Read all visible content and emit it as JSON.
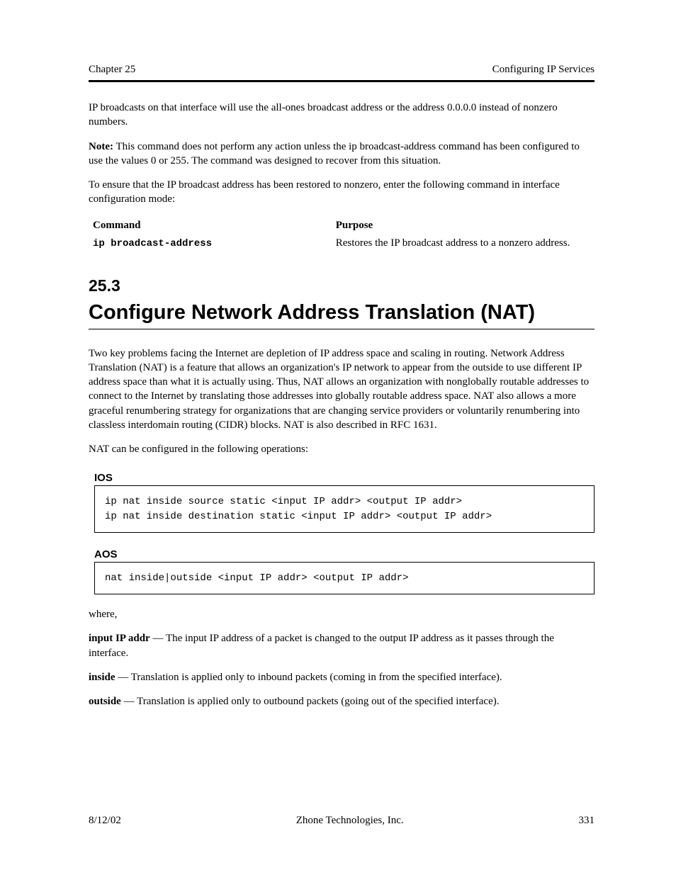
{
  "header": {
    "left": "Chapter 25",
    "right": "Configuring IP Services"
  },
  "para1": "IP broadcasts on that interface will use the all-ones broadcast address or the address 0.0.0.0 instead of nonzero numbers.",
  "note_lead": "Note:",
  "note_body": "This command does not perform any action unless the ip broadcast-address command has been configured to use the values 0 or 255. The command was designed to recover from this situation.",
  "para2": "To ensure that the IP broadcast address has been restored to nonzero, enter the following command in interface configuration mode:",
  "table1": {
    "cmd_label": "Command",
    "purpose_label": "Purpose",
    "cmd": "ip broadcast-address",
    "purpose": "Restores the IP broadcast address to a nonzero address."
  },
  "section": {
    "num": "25.3",
    "title": "Configure Network Address Translation (NAT)"
  },
  "para3": "Two key problems facing the Internet are depletion of IP address space and scaling in routing. Network Address Translation (NAT) is a feature that allows an organization's IP network to appear from the outside to use different IP address space than what it is actually using. Thus, NAT allows an organization with nonglobally routable addresses to connect to the Internet by translating those addresses into globally routable address space. NAT also allows a more graceful renumbering strategy for organizations that are changing service providers or voluntarily renumbering into classless interdomain routing (CIDR) blocks. NAT is also described in RFC 1631.",
  "para4": "NAT can be configured in the following operations:",
  "label1": "IOS",
  "code1_line1": "ip nat inside source static <input IP addr> <output IP addr>",
  "code1_line2": "ip nat inside destination static <input IP addr> <output IP addr>",
  "label2": "AOS",
  "code2": "nat inside|outside <input IP addr> <output IP addr>",
  "para5": "where,",
  "para6_lead": "input IP addr",
  "para6_rest": " — The input IP address of a packet is changed to the output IP address as it passes through the interface.",
  "para7_lead": "inside",
  "para7_rest": " — Translation is applied only to inbound packets (coming in from the specified interface).",
  "para8_lead": "outside",
  "para8_rest": " — Translation is applied only to outbound packets (going out of the specified interface).",
  "footer": {
    "left": "8/12/02",
    "center": "Zhone Technologies, Inc.",
    "right": "331"
  }
}
